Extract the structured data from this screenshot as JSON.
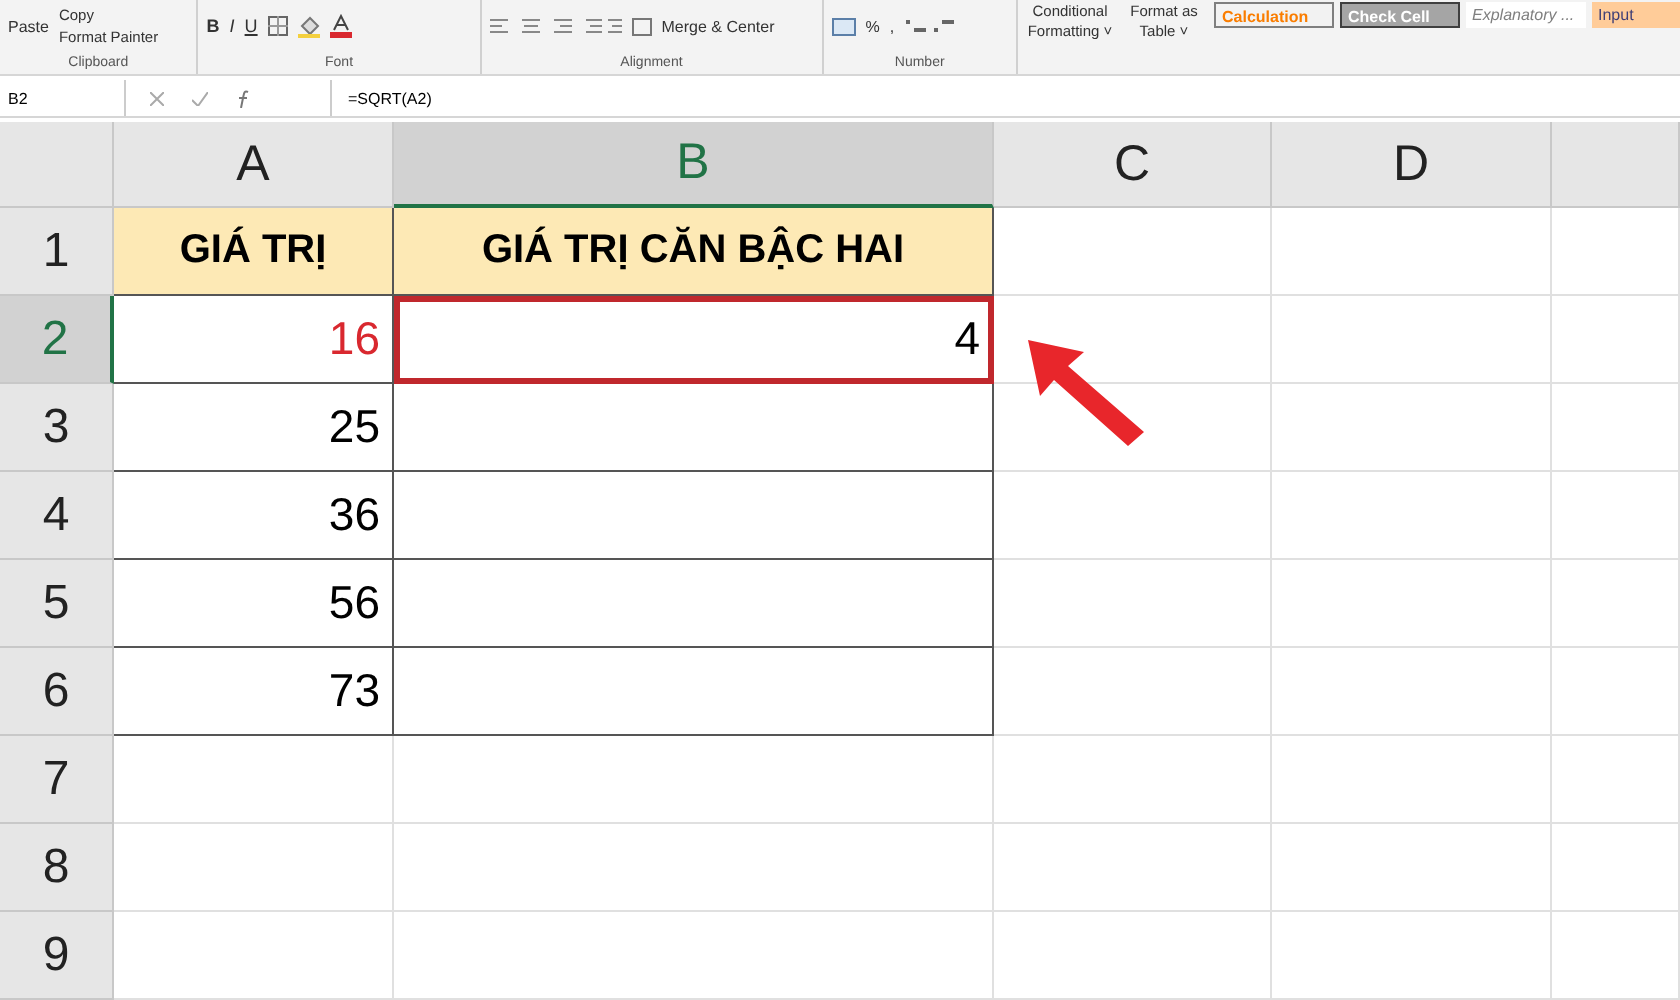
{
  "ribbon": {
    "clipboard": {
      "paste": "Paste",
      "copy": "Copy",
      "format_painter": "Format Painter",
      "label": "Clipboard"
    },
    "font": {
      "bold": "B",
      "italic": "I",
      "underline": "U",
      "label": "Font"
    },
    "alignment": {
      "merge": "Merge & Center",
      "label": "Alignment"
    },
    "number": {
      "percent": "%",
      "comma": ",",
      "label": "Number"
    },
    "styles": [
      {
        "kind": "command",
        "text": "Conditional Formatting ˅"
      },
      {
        "kind": "command",
        "text": "Format as Table ˅"
      },
      {
        "kind": "calculation",
        "text": "Calculation"
      },
      {
        "kind": "check",
        "text": "Check Cell"
      },
      {
        "kind": "explanatory",
        "text": "Explanatory ..."
      },
      {
        "kind": "input",
        "text": "Input"
      }
    ]
  },
  "formula_bar": {
    "name_box": "B2",
    "formula": "=SQRT(A2)"
  },
  "sheet": {
    "columns": [
      {
        "label": "A",
        "selected": false
      },
      {
        "label": "B",
        "selected": true
      },
      {
        "label": "C",
        "selected": false
      },
      {
        "label": "D",
        "selected": false
      }
    ],
    "rows": [
      {
        "label": "1",
        "selected": false,
        "cells": [
          {
            "kind": "heading",
            "text": "GIÁ TRỊ",
            "selected": false
          },
          {
            "kind": "heading",
            "text": "GIÁ TRỊ CĂN BẬC HAI",
            "selected": false
          }
        ]
      },
      {
        "label": "2",
        "selected": true,
        "cells": [
          {
            "kind": "flagged",
            "text": "16",
            "selected": false
          },
          {
            "kind": "number",
            "text": "4",
            "selected": true
          }
        ]
      },
      {
        "label": "3",
        "selected": false,
        "cells": [
          {
            "kind": "number",
            "text": "25",
            "selected": false
          },
          {
            "kind": "empty",
            "selected": false
          }
        ]
      },
      {
        "label": "4",
        "selected": false,
        "cells": [
          {
            "kind": "number",
            "text": "36",
            "selected": false
          },
          {
            "kind": "empty",
            "selected": false
          }
        ]
      },
      {
        "label": "5",
        "selected": false,
        "cells": [
          {
            "kind": "number",
            "text": "56",
            "selected": false
          },
          {
            "kind": "empty",
            "selected": false
          }
        ]
      },
      {
        "label": "6",
        "selected": false,
        "cells": [
          {
            "kind": "number",
            "text": "73",
            "selected": false
          },
          {
            "kind": "empty",
            "selected": false
          }
        ]
      },
      {
        "label": "7",
        "selected": false,
        "cells": []
      },
      {
        "label": "8",
        "selected": false,
        "cells": []
      },
      {
        "label": "9",
        "selected": false,
        "cells": []
      }
    ]
  }
}
